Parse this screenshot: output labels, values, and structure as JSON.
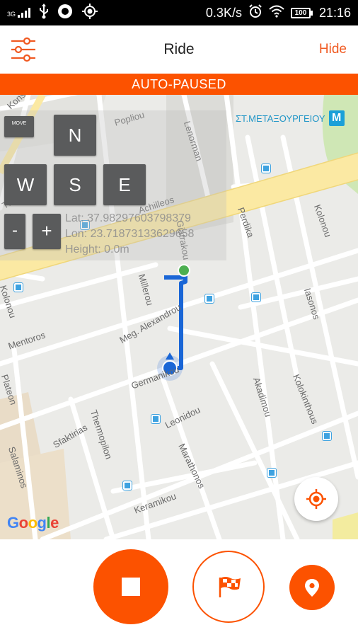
{
  "status_bar": {
    "signal_label": "3G",
    "network_speed": "0.3K/s",
    "battery_level": "100",
    "time": "21:16",
    "icons": [
      "signal-icon",
      "usb-icon",
      "record-icon",
      "gps-icon",
      "alarm-icon",
      "wifi-icon",
      "battery-icon"
    ]
  },
  "app_bar": {
    "title": "Ride",
    "hide_label": "Hide",
    "menu_icon": "sliders-icon"
  },
  "banner": {
    "text": "AUTO-PAUSED"
  },
  "controls": {
    "move_label": "MOVE",
    "north": "N",
    "west": "W",
    "south": "S",
    "east": "E",
    "minus": "-",
    "plus": "+",
    "lat": "Lat: 37.98297603798379",
    "lon": "Lon: 23.71873133629658",
    "height": "Height: 0.0m"
  },
  "map": {
    "metro_station": "ΣΤ.ΜΕΤΑΞΟΥΡΓΕΙΟΥ",
    "metro_icon": "M",
    "streets": {
      "konstantinoupoleos": "Konstant",
      "popliou": "Popliou",
      "lenorman": "Lenorman",
      "achilleos": "Achilleos",
      "giatrakou": "Giatrakou",
      "perdika": "Perdika",
      "kolonou": "Kolonou",
      "thessalias": "Thessal",
      "millerou": "Millerou",
      "iasonos": "Iasonos",
      "kolonou2": "Kolonou",
      "mentoros": "Mentoros",
      "meg_alexandrou": "Meg. Alexandrou",
      "germanikou": "Germanikou",
      "plateon": "Plateon",
      "akadimou": "Akadimou",
      "kolokinthous": "Kolokinthous",
      "thermopilon": "Thermopilon",
      "leonidou": "Leonidou",
      "sfaktirias": "Sfaktirias",
      "salaminos": "Salaminos",
      "marathonos": "Marathonos",
      "keramikou": "Keramikou"
    },
    "google_logo": [
      "G",
      "o",
      "o",
      "g",
      "l",
      "e"
    ],
    "google_colors": [
      "#4285F4",
      "#EA4335",
      "#FBBC05",
      "#4285F4",
      "#34A853",
      "#EA4335"
    ],
    "route_color": "#1a66d6",
    "start_color": "#4caf50",
    "locate_icon": "my-location-icon"
  },
  "bottom": {
    "stop_icon": "stop-icon",
    "lap_icon": "flag-icon",
    "pin_icon": "map-pin-icon"
  },
  "colors": {
    "accent": "#fc5200"
  }
}
